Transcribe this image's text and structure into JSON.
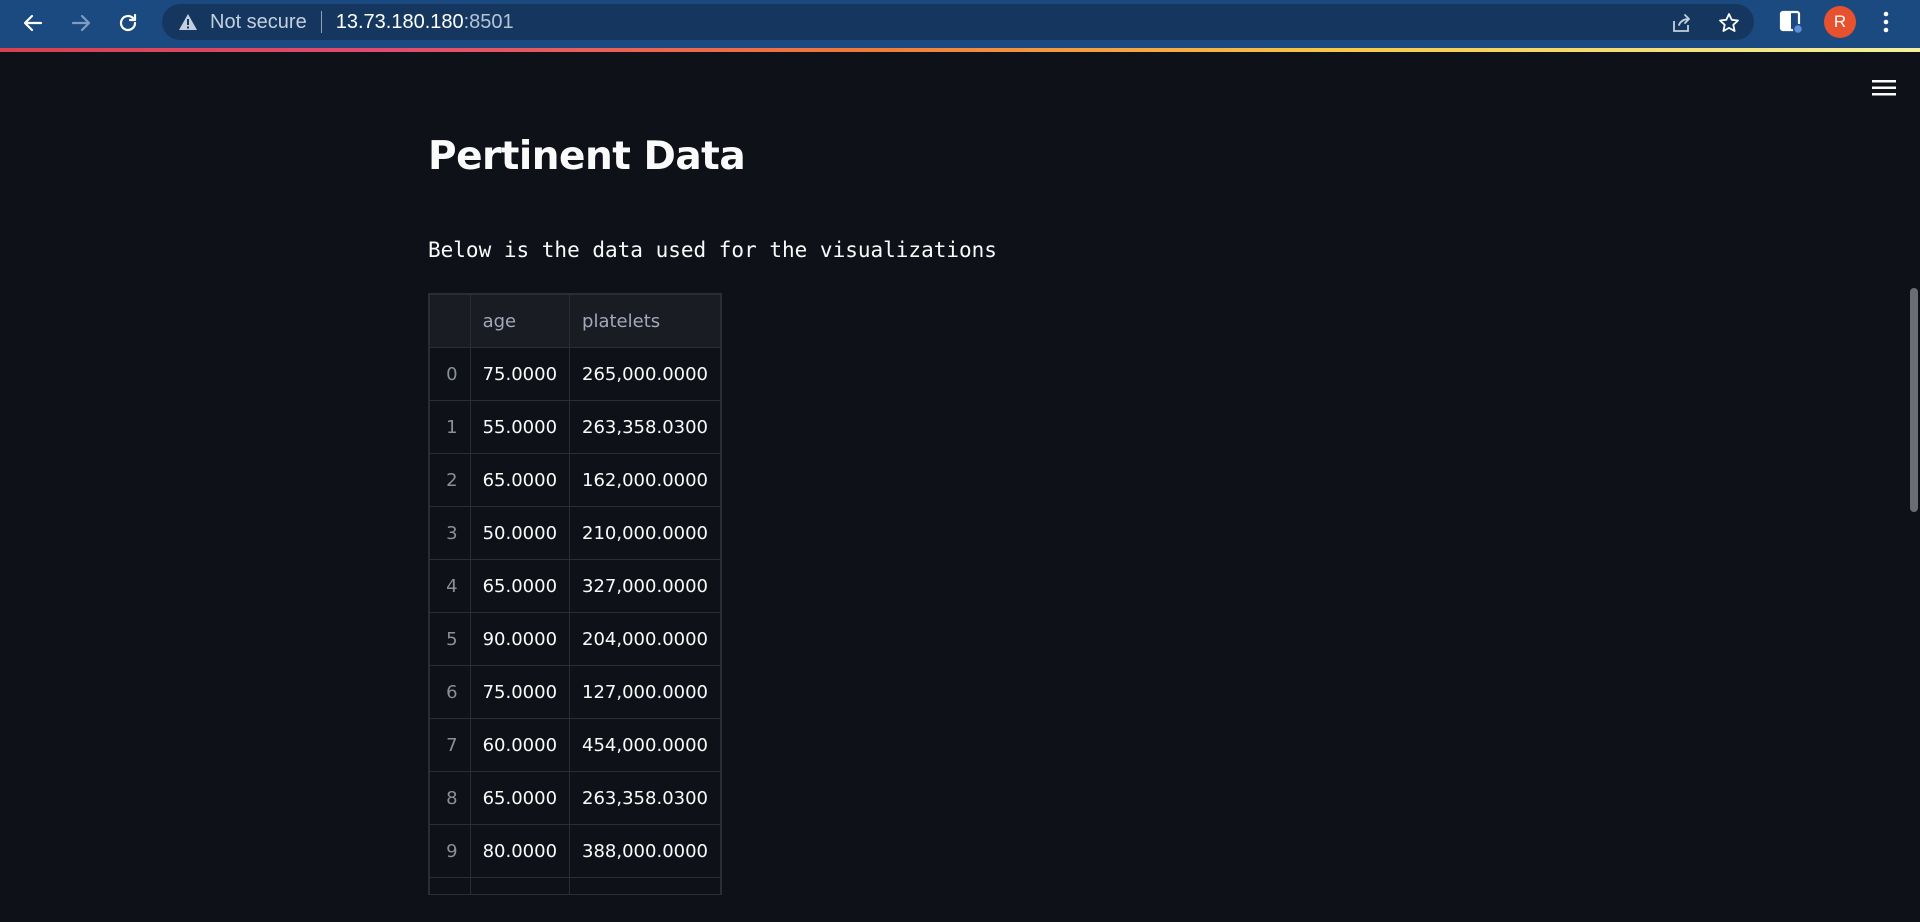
{
  "browser": {
    "security_label": "Not secure",
    "url_host": "13.73.180.180",
    "url_port": ":8501",
    "profile_initial": "R"
  },
  "page": {
    "title": "Pertinent Data",
    "subtitle": "Below is the data used for the visualizations"
  },
  "table": {
    "columns": [
      "age",
      "platelets"
    ],
    "rows": [
      {
        "index": "0",
        "age": "75.0000",
        "platelets": "265,000.0000"
      },
      {
        "index": "1",
        "age": "55.0000",
        "platelets": "263,358.0300"
      },
      {
        "index": "2",
        "age": "65.0000",
        "platelets": "162,000.0000"
      },
      {
        "index": "3",
        "age": "50.0000",
        "platelets": "210,000.0000"
      },
      {
        "index": "4",
        "age": "65.0000",
        "platelets": "327,000.0000"
      },
      {
        "index": "5",
        "age": "90.0000",
        "platelets": "204,000.0000"
      },
      {
        "index": "6",
        "age": "75.0000",
        "platelets": "127,000.0000"
      },
      {
        "index": "7",
        "age": "60.0000",
        "platelets": "454,000.0000"
      },
      {
        "index": "8",
        "age": "65.0000",
        "platelets": "263,358.0300"
      },
      {
        "index": "9",
        "age": "80.0000",
        "platelets": "388,000.0000"
      }
    ]
  },
  "colors": {
    "background": "#0e1117",
    "chrome": "#1a4a80",
    "text": "#fafafa",
    "avatar": "#e8512d"
  }
}
